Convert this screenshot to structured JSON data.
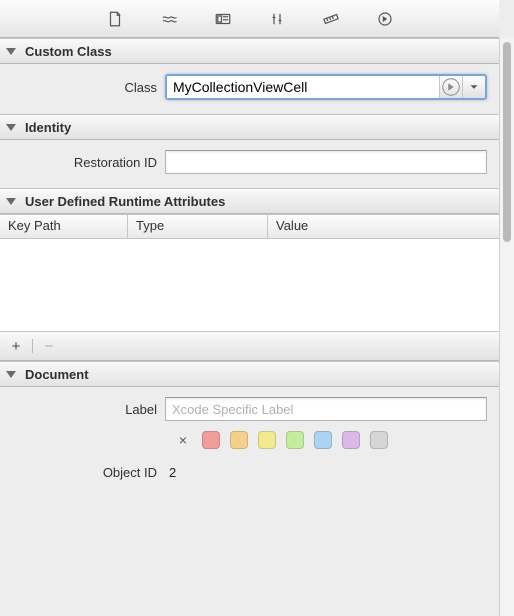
{
  "toolbar_icons": [
    "file-icon",
    "wave-icon",
    "identity-icon",
    "measure-icon",
    "ruler-icon",
    "arrow-icon"
  ],
  "sections": {
    "custom_class": {
      "title": "Custom Class",
      "class_label": "Class",
      "class_value": "MyCollectionViewCell"
    },
    "identity": {
      "title": "Identity",
      "restoration_label": "Restoration ID",
      "restoration_value": ""
    },
    "runtime_attrs": {
      "title": "User Defined Runtime Attributes",
      "columns": {
        "key_path": "Key Path",
        "type": "Type",
        "value": "Value"
      },
      "rows": []
    },
    "document": {
      "title": "Document",
      "label_label": "Label",
      "label_placeholder": "Xcode Specific Label",
      "label_value": "",
      "colors": [
        "#f29c9c",
        "#f6cf8a",
        "#f3ea8e",
        "#c6ec9d",
        "#abd4f4",
        "#dcb8e8",
        "#d6d6d6"
      ],
      "object_id_label": "Object ID",
      "object_id_value": "2"
    }
  },
  "buttons": {
    "add": "+",
    "remove": "−",
    "clear": "×"
  }
}
